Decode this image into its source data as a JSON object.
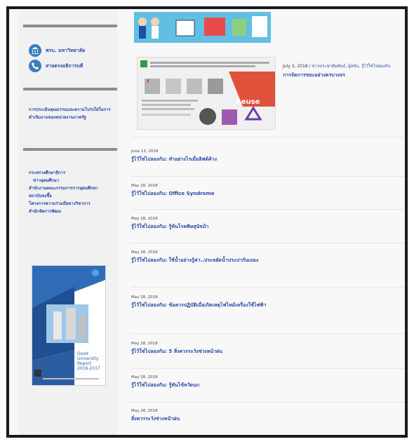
{
  "sidebar": {
    "links": [
      {
        "label": "พรบ. มหาวิทยาลัย",
        "icon": "university-icon"
      },
      {
        "label": "สายตรงอธิการบดี",
        "icon": "phone-icon"
      }
    ],
    "assessment_text": "การประเมินคุณธรรมและความโปร่งใสในการดำเนินงานของหน่วยงานภาครัฐ",
    "menu": [
      "กระทรวงศึกษาธิการ",
      "ข่าวอุดมศึกษา",
      "สำนักงานคณะกรรมการการอุดมศึกษา",
      "สถาบันขงจื๊อ",
      "โครงการความร่วมมือทางวิชาการ",
      "สำนักจัดการพัฒน"
    ],
    "report": {
      "line1": "Good",
      "line2": "University",
      "line3": "Report",
      "line4": "2016-2017"
    }
  },
  "feature": {
    "date": "July 3, 2018",
    "sep": "/",
    "categories": "ข่าวประชาสัมพันธ์, ผู้สนับ, รู้ไว้ใช่ไปลองกัน",
    "title": "การจัดการขยะอย่างครบวงจร",
    "image_label": "Reuse"
  },
  "posts": [
    {
      "date": "June 13, 2018",
      "title": "รู้ไว้ใช่ไปลองกัน: ทำอย่างไรเมื่อลิฟต์ค้าง"
    },
    {
      "date": "May 28, 2018",
      "title": "รู้ไว้ใช่ไปลองกัน: Office Syndrome"
    },
    {
      "date": "May 28, 2018",
      "title": "รู้ไว้ใช่ไปลองกัน: รู้ทันโรคพิษสุนัขบ้า"
    },
    {
      "date": "May 28, 2018",
      "title": "รู้ไว้ใช่ไปลองกัน: ใช้น้ำอย่างรู้ค่า..ประหยัดน้ำประปากันเถอะ"
    },
    {
      "date": "May 28, 2018",
      "title": "รู้ไว้ใช่ไปลองกัน: ข้อควรปฏิบัติเมื่อเกิดเหตุไฟไหม้เครื่องใช้ไฟฟ้า"
    },
    {
      "date": "May 28, 2018",
      "title": "รู้ไว้ใช่ไปลองกัน: 5 สิ่งควรระวังช่วงหน้าฝน"
    },
    {
      "date": "May 28, 2018",
      "title": "รู้ไว้ใช่ไปลองกัน: รู้ทันไข้หวัดนก"
    },
    {
      "date": "May 28, 2018",
      "title": "สิ่งควรระวังช่วงหน้าฝน"
    }
  ],
  "colors": {
    "link": "#2b4aa8",
    "icon": "#3a7fc0",
    "rule": "#8c8c8c"
  }
}
